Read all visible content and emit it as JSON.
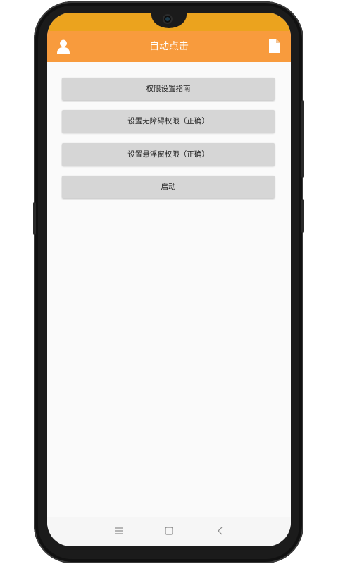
{
  "app_bar": {
    "title": "自动点击",
    "left_icon": "user-icon",
    "right_icon": "document-icon"
  },
  "buttons": [
    {
      "label": "权限设置指南"
    },
    {
      "label": "设置无障碍权限（正确）"
    },
    {
      "label": "设置悬浮窗权限（正确）"
    },
    {
      "label": "启动"
    }
  ],
  "nav_bar": {
    "icons": [
      "menu-icon",
      "home-icon",
      "back-icon"
    ]
  },
  "colors": {
    "status_bar": "#eba31e",
    "app_bar": "#f89b3d",
    "button_bg": "#d6d6d6",
    "screen_bg": "#fafafa"
  }
}
